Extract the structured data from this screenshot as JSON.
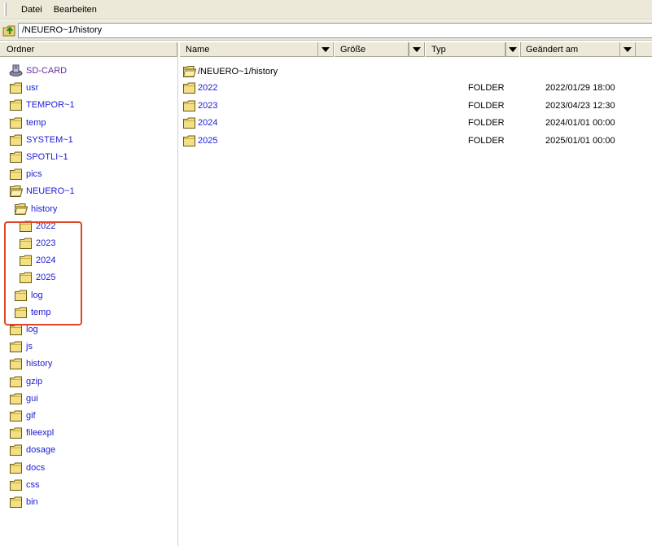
{
  "menu": {
    "items": [
      "Datei",
      "Bearbeiten"
    ]
  },
  "address": {
    "path": "/NEUERO~1/history"
  },
  "tree": {
    "header": "Ordner",
    "items": [
      {
        "label": "SD-CARD",
        "icon": "drive-icon",
        "indent": 0,
        "open": false
      },
      {
        "label": "usr",
        "indent": 0,
        "open": false
      },
      {
        "label": "TEMPOR~1",
        "indent": 0,
        "open": false
      },
      {
        "label": "temp",
        "indent": 0,
        "open": false
      },
      {
        "label": "SYSTEM~1",
        "indent": 0,
        "open": false
      },
      {
        "label": "SPOTLI~1",
        "indent": 0,
        "open": false
      },
      {
        "label": "pics",
        "indent": 0,
        "open": false
      },
      {
        "label": "NEUERO~1",
        "indent": 0,
        "open": true
      },
      {
        "label": "history",
        "indent": 1,
        "open": true
      },
      {
        "label": "2022",
        "indent": 2,
        "open": false
      },
      {
        "label": "2023",
        "indent": 2,
        "open": false
      },
      {
        "label": "2024",
        "indent": 2,
        "open": false
      },
      {
        "label": "2025",
        "indent": 2,
        "open": false
      },
      {
        "label": "log",
        "indent": 1,
        "open": false
      },
      {
        "label": "temp",
        "indent": 1,
        "open": false
      },
      {
        "label": "log",
        "indent": 0,
        "open": false
      },
      {
        "label": "js",
        "indent": 0,
        "open": false
      },
      {
        "label": "history",
        "indent": 0,
        "open": false
      },
      {
        "label": "gzip",
        "indent": 0,
        "open": false
      },
      {
        "label": "gui",
        "indent": 0,
        "open": false
      },
      {
        "label": "gif",
        "indent": 0,
        "open": false
      },
      {
        "label": "fileexpl",
        "indent": 0,
        "open": false
      },
      {
        "label": "dosage",
        "indent": 0,
        "open": false
      },
      {
        "label": "docs",
        "indent": 0,
        "open": false
      },
      {
        "label": "css",
        "indent": 0,
        "open": false
      },
      {
        "label": "bin",
        "indent": 0,
        "open": false
      }
    ]
  },
  "list": {
    "columns": [
      "Name",
      "Größe",
      "Typ",
      "Geändert am"
    ],
    "current": {
      "label": "/NEUERO~1/history"
    },
    "rows": [
      {
        "name": "2022",
        "type": "FOLDER",
        "date": "2022/01/29 18:00"
      },
      {
        "name": "2023",
        "type": "FOLDER",
        "date": "2023/04/23 12:30"
      },
      {
        "name": "2024",
        "type": "FOLDER",
        "date": "2024/01/01 00:00"
      },
      {
        "name": "2025",
        "type": "FOLDER",
        "date": "2025/01/01 00:00"
      }
    ]
  },
  "colors": {
    "link": "#1a1ad6",
    "root": "#6a2aa0",
    "highlight": "#e0452c",
    "chrome": "#ece9d8"
  }
}
